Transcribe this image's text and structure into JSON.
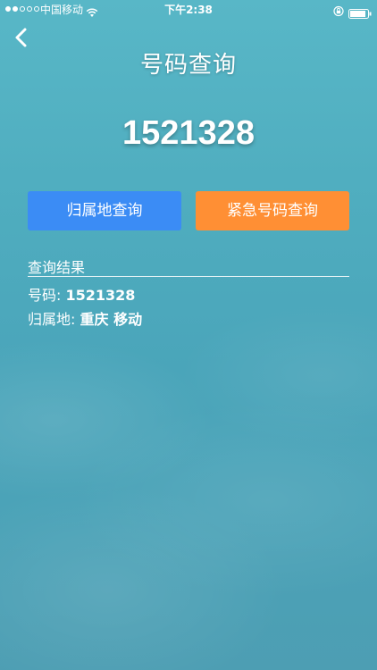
{
  "status_bar": {
    "carrier": "中国移动",
    "time": "下午2:38"
  },
  "header": {
    "title": "号码查询"
  },
  "query": {
    "number": "1521328"
  },
  "buttons": {
    "location_query": "归属地查询",
    "emergency_query": "紧急号码查询",
    "location_query_color": "#3b8cf5",
    "emergency_query_color": "#ff8f34"
  },
  "results": {
    "heading": "查询结果",
    "number_label": "号码:",
    "number_value": "1521328",
    "location_label": "归属地:",
    "location_value": "重庆 移动"
  },
  "icons": {
    "back": "chevron-left-icon",
    "wifi": "wifi-icon",
    "lock": "orientation-lock-icon",
    "battery": "battery-icon"
  }
}
